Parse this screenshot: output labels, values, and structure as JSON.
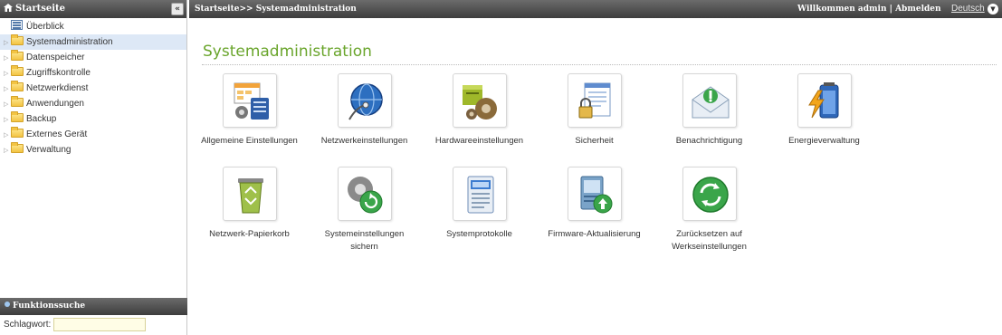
{
  "sidebar": {
    "header": "Startseite",
    "collapse_glyph": "«",
    "items": [
      {
        "label": "Überblick",
        "icon": "overview-icon"
      },
      {
        "label": "Systemadministration",
        "icon": "folder-icon"
      },
      {
        "label": "Datenspeicher",
        "icon": "folder-icon"
      },
      {
        "label": "Zugriffskontrolle",
        "icon": "folder-icon"
      },
      {
        "label": "Netzwerkdienst",
        "icon": "folder-icon"
      },
      {
        "label": "Anwendungen",
        "icon": "folder-icon"
      },
      {
        "label": "Backup",
        "icon": "folder-icon"
      },
      {
        "label": "Externes Gerät",
        "icon": "folder-icon"
      },
      {
        "label": "Verwaltung",
        "icon": "folder-icon"
      }
    ],
    "search": {
      "header": "Funktionssuche",
      "label": "Schlagwort:",
      "value": ""
    }
  },
  "topbar": {
    "breadcrumb": "Startseite>> Systemadministration",
    "welcome": "Willkommen admin |",
    "logout": "Abmelden",
    "language": "Deutsch"
  },
  "main": {
    "title": "Systemadministration",
    "tiles": [
      {
        "label": "Allgemeine Einstellungen",
        "label2": "",
        "icon": "general-settings-icon"
      },
      {
        "label": "Netzwerkeinstellungen",
        "label2": "",
        "icon": "network-globe-icon"
      },
      {
        "label": "Hardwareeinstellungen",
        "label2": "",
        "icon": "hardware-gear-icon"
      },
      {
        "label": "Sicherheit",
        "label2": "",
        "icon": "security-lock-icon"
      },
      {
        "label": "Benachrichtigung",
        "label2": "",
        "icon": "notification-mail-icon"
      },
      {
        "label": "Energieverwaltung",
        "label2": "",
        "icon": "power-battery-icon"
      },
      {
        "label": "Netzwerk-Papierkorb",
        "label2": "",
        "icon": "recycle-bin-icon"
      },
      {
        "label": "Systemeinstellungen",
        "label2": "sichern",
        "icon": "backup-settings-icon"
      },
      {
        "label": "Systemprotokolle",
        "label2": "",
        "icon": "system-log-icon"
      },
      {
        "label": "Firmware-Aktualisierung",
        "label2": "",
        "icon": "firmware-update-icon"
      },
      {
        "label": "Zurücksetzen auf",
        "label2": "Werkseinstellungen",
        "icon": "factory-reset-icon"
      }
    ]
  },
  "colors": {
    "accent_green": "#6aa52c",
    "header_dark": "#3d3d3d",
    "selected_bg": "#dde8f6"
  }
}
